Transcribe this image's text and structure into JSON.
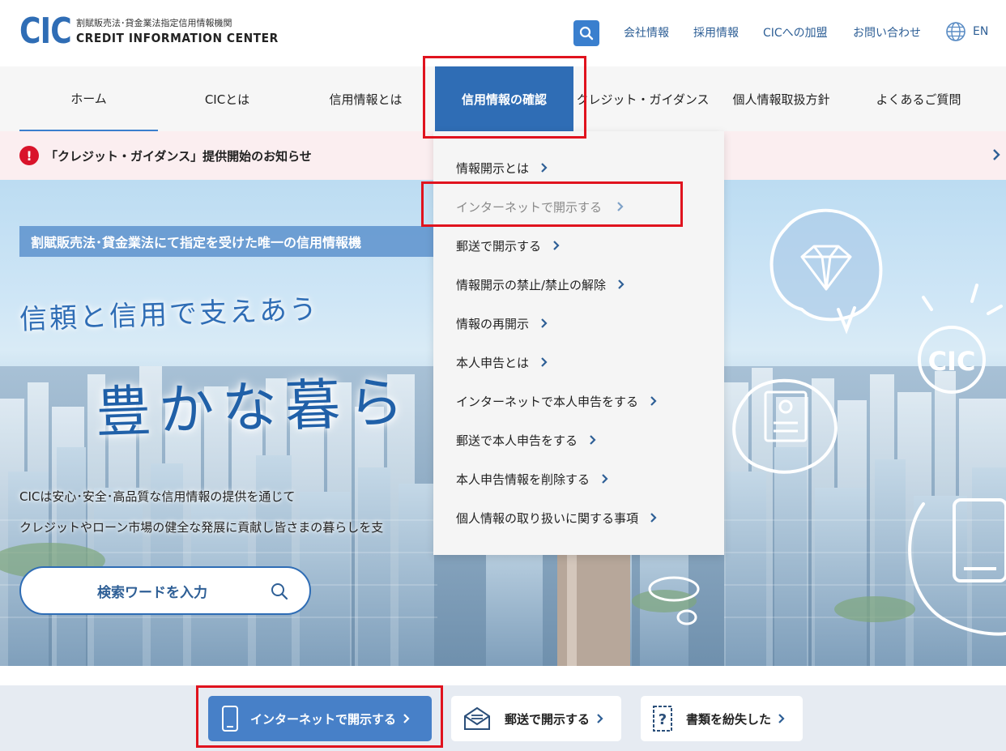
{
  "header": {
    "logo_mark": "CIC",
    "logo_subtitle": "割賦販売法･貸金業法指定信用情報機関",
    "logo_title": "CREDIT INFORMATION CENTER",
    "search_icon": "search-icon",
    "links": [
      "会社情報",
      "採用情報",
      "CICへの加盟",
      "お問い合わせ"
    ],
    "lang_icon": "globe-icon",
    "lang_label": "EN"
  },
  "nav": {
    "items": [
      "ホーム",
      "CICとは",
      "信用情報とは",
      "信用情報の確認",
      "クレジット・ガイダンス",
      "個人情報取扱方針",
      "よくあるご質問"
    ],
    "current": "信用情報の確認"
  },
  "notice": {
    "icon": "alert-icon",
    "text": "「クレジット・ガイダンス」提供開始のお知らせ"
  },
  "dropdown": {
    "items": [
      "情報開示とは",
      "インターネットで開示する",
      "郵送で開示する",
      "情報開示の禁止/禁止の解除",
      "情報の再開示",
      "本人申告とは",
      "インターネットで本人申告をする",
      "郵送で本人申告をする",
      "本人申告情報を削除する",
      "個人情報の取り扱いに関する事項"
    ],
    "hovered": "インターネットで開示する"
  },
  "hero": {
    "badge": "割賦販売法･貸金業法にて指定を受けた唯一の信用情報機",
    "tagline": "信頼と信用で支えあう",
    "title": "豊かな暮ら",
    "desc_line1": "CICは安心･安全･高品質な信用情報の提供を通じて",
    "desc_line2": "クレジットやローン市場の健全な発展に貢献し皆さまの暮らしを支",
    "illustration_text": "CIC",
    "search_placeholder": "検索ワードを入力"
  },
  "quick_links": [
    {
      "label": "インターネットで開示する",
      "icon": "smartphone-icon"
    },
    {
      "label": "郵送で開示する",
      "icon": "envelope-icon"
    },
    {
      "label": "書類を紛失した",
      "icon": "question-document-icon"
    }
  ],
  "colors": {
    "brand_blue": "#2f6db5",
    "link_blue": "#2e5f96",
    "alert_red": "#d9142b",
    "highlight_red": "#e0131e"
  }
}
